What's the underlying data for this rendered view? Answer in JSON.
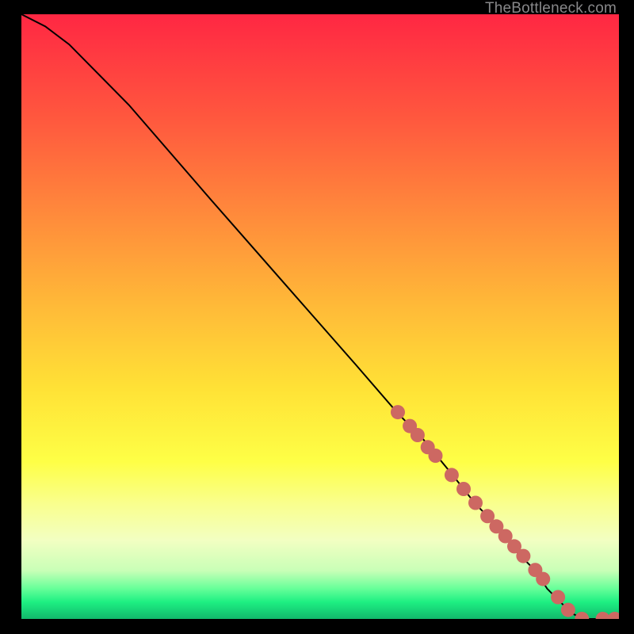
{
  "watermark": "TheBottleneck.com",
  "chart_data": {
    "type": "line",
    "title": "",
    "xlabel": "",
    "ylabel": "",
    "xlim": [
      0,
      100
    ],
    "ylim": [
      0,
      100
    ],
    "curve": {
      "x": [
        0,
        4,
        8,
        12,
        18,
        25,
        32,
        40,
        48,
        56,
        63,
        67,
        72,
        76,
        80,
        83,
        86,
        88,
        90,
        92,
        94,
        96,
        98,
        100
      ],
      "y": [
        100,
        98,
        95,
        91,
        85,
        77,
        69,
        60,
        51,
        42,
        34,
        30,
        24,
        19,
        15,
        11,
        8,
        5,
        3,
        1,
        0,
        0,
        0,
        0
      ]
    },
    "markers": {
      "x": [
        63.0,
        65.0,
        66.3,
        68.0,
        69.3,
        72.0,
        74.0,
        76.0,
        78.0,
        79.5,
        81.0,
        82.5,
        84.0,
        86.0,
        87.3,
        89.8,
        91.5,
        93.8,
        97.3,
        99.3
      ],
      "y": [
        34.2,
        31.9,
        30.4,
        28.4,
        27.0,
        23.8,
        21.5,
        19.2,
        17.0,
        15.3,
        13.7,
        12.0,
        10.4,
        8.1,
        6.6,
        3.6,
        1.5,
        0.0,
        0.0,
        0.0
      ]
    },
    "colors": {
      "curve": "#000000",
      "marker": "#cd6862"
    }
  }
}
